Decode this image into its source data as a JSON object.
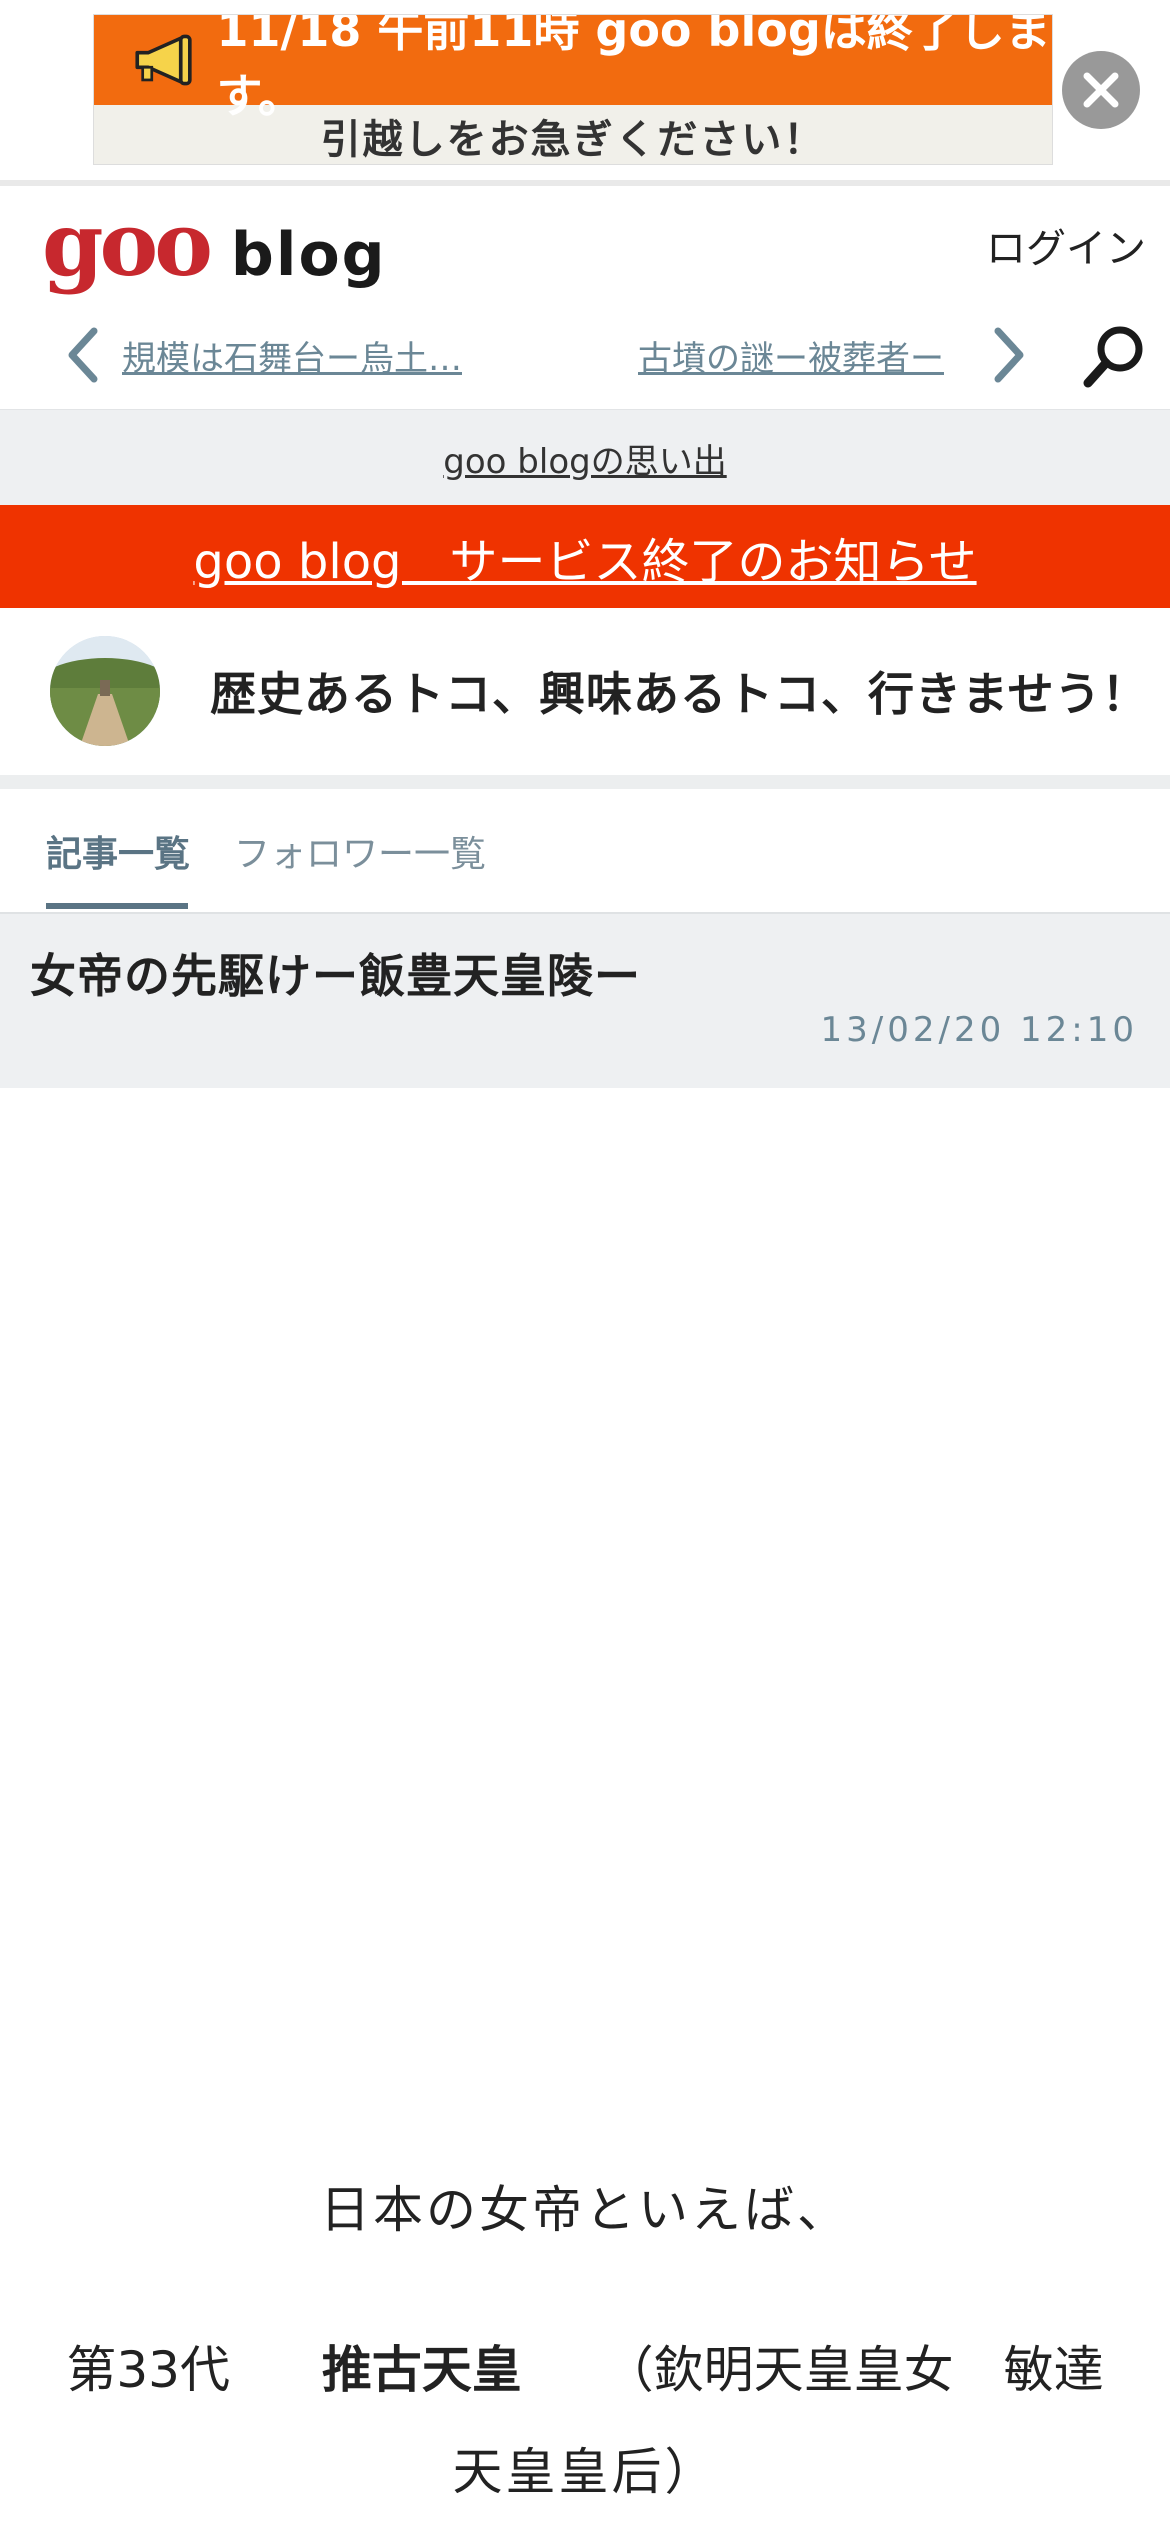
{
  "banner": {
    "headline": "11/18 午前11時 goo blogは終了します。",
    "subline": "引越しをお急ぎください！",
    "colors": {
      "top": "#f26b0f",
      "bottom": "#f1f0ea"
    }
  },
  "header": {
    "logo_goo": "goo",
    "logo_blog": "blog",
    "login_label": "ログイン"
  },
  "article_nav": {
    "prev_title": "規模は石舞台ー烏土…",
    "next_title": "古墳の謎ー被葬者ー"
  },
  "memory_link": "goo blogの思い出",
  "notice_link": "goo blog　サービス終了のお知らせ",
  "blog": {
    "title": "歴史あるトコ、興味あるトコ、行きませう！"
  },
  "tabs": [
    {
      "label": "記事一覧",
      "active": true
    },
    {
      "label": "フォロワー一覧",
      "active": false
    }
  ],
  "article": {
    "title": "女帝の先駆けー飯豊天皇陵ー",
    "date": "13/02/20 12:10",
    "body": {
      "line1": "日本の女帝といえば、",
      "line2_prefix": "第33代",
      "line2_bold": "推古天皇",
      "line2_suffix": "（欽明天皇皇女　敏達",
      "line3": "天皇皇后）"
    }
  },
  "colors": {
    "notice_red": "#ef3300",
    "link_blue_gray": "#6b8796",
    "goo_red": "#c7282e"
  }
}
